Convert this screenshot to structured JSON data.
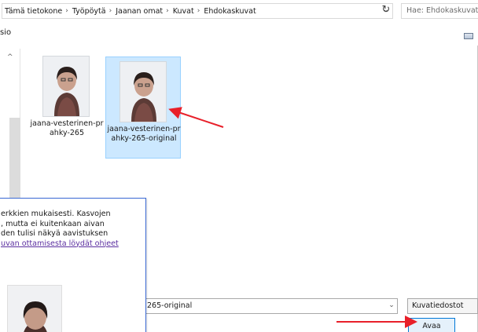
{
  "address_bar": {
    "breadcrumbs": [
      "Tämä tietokone",
      "Työpöytä",
      "Jaanan omat",
      "Kuvat",
      "Ehdokaskuvat"
    ],
    "separator": "›",
    "dropdown_glyph": "⌄",
    "refresh_glyph": "↻"
  },
  "search": {
    "placeholder": "Hae: Ehdokaskuvat"
  },
  "command_bar": {
    "label": "sio"
  },
  "nav_pane": {
    "collapse_glyph": "^"
  },
  "files": [
    {
      "name": "jaana-vesterinen-prahky-265",
      "selected": false
    },
    {
      "name": "jaana-vesterinen-prahky-265-original",
      "selected": true
    }
  ],
  "filename_field": {
    "value": "265-original",
    "dropdown_glyph": "⌄"
  },
  "filetype_select": {
    "value": "Kuvatiedostot"
  },
  "open_button": {
    "label": "Avaa"
  },
  "info_panel": {
    "lines": [
      "erkkien mukaisesti. Kasvojen",
      ", mutta ei kuitenkaan aivan",
      "den tulisi näkyä aavistuksen"
    ],
    "link_text": "uvan ottamisesta löydät ohjeet"
  },
  "colors": {
    "selection_fill": "#cce8ff",
    "selection_border": "#99d1ff",
    "primary_button_border": "#0078d7",
    "annotation_red": "#e8202a",
    "panel_border": "#3b6ad4",
    "link": "#5b2fa0"
  }
}
